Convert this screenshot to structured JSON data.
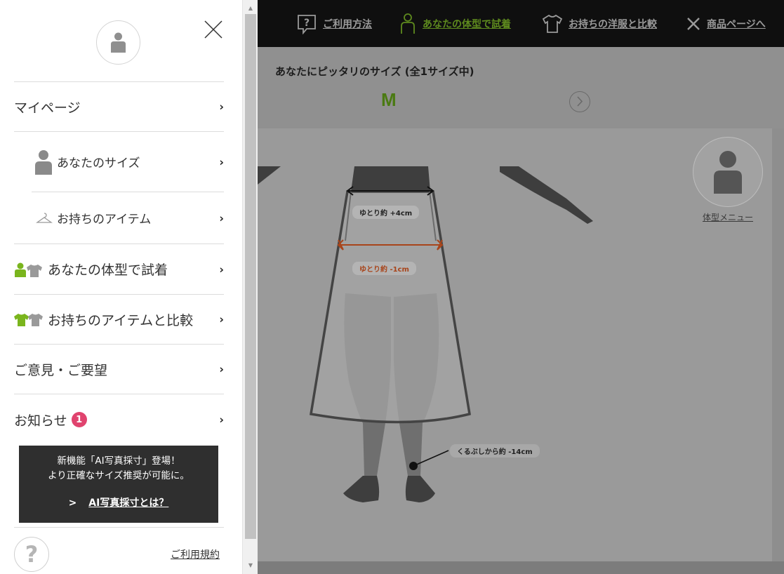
{
  "topnav": {
    "how_to_use": "ご利用方法",
    "try_on_body": "あなたの体型で試着",
    "compare_clothes": "お持ちの洋服と比較",
    "product_page": "商品ページへ"
  },
  "size_panel": {
    "title": "あなたにピッタリのサイズ (全1サイズ中)",
    "recommended_size": "M"
  },
  "fit_labels": {
    "waist": "ゆとり約 +4cm",
    "hip": "ゆとり約 -1cm",
    "length": "くるぶしから約 -14cm"
  },
  "body_menu": {
    "label": "体型メニュー"
  },
  "drawer": {
    "menu": {
      "mypage": "マイページ",
      "your_size": "あなたのサイズ",
      "your_items": "お持ちのアイテム",
      "try_on": "あなたの体型で試着",
      "compare_items": "お持ちのアイテムと比較",
      "feedback": "ご意見・ご要望",
      "notice": "お知らせ",
      "notice_count": "1"
    },
    "promo": {
      "line1": "新機能「AI写真採寸」登場！",
      "line2": "より正確なサイズ推奨が可能に。",
      "link_arrow": ">",
      "link": "AI写真採寸とは？"
    },
    "help_symbol": "?",
    "terms": "ご利用規約"
  },
  "colors": {
    "accent_green": "#7ab51d",
    "badge_pink": "#e0436e",
    "promo_bg": "#2f2f2f",
    "warn_orange": "#a8441a"
  }
}
